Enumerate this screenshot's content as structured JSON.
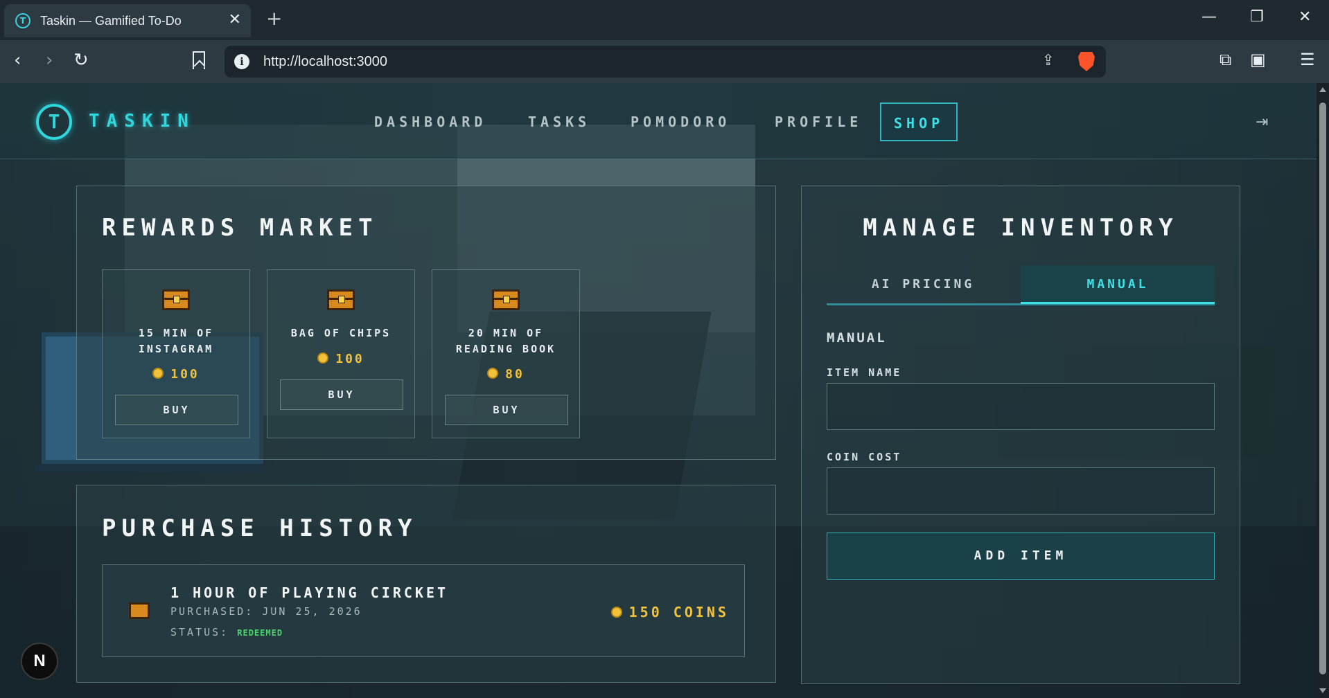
{
  "browser": {
    "tab_title": "Taskin — Gamified To-Do",
    "tab_close": "✕",
    "new_tab": "+",
    "url": "http://localhost:3000",
    "minimize": "—",
    "restore": "❐",
    "close": "✕"
  },
  "app": {
    "logo_letter": "T",
    "brand": "TASKIN",
    "nav": {
      "dashboard": "DASHBOARD",
      "tasks": "TASKS",
      "pomodoro": "POMODORO",
      "profile": "PROFILE",
      "shop": "SHOP"
    },
    "logout_icon": "logout-icon"
  },
  "market": {
    "title": "REWARDS MARKET",
    "items": [
      {
        "name_line1": "15 MIN OF",
        "name_line2": "INSTAGRAM",
        "price": "100",
        "buy": "BUY"
      },
      {
        "name_line1": "BAG OF CHIPS",
        "name_line2": "",
        "price": "100",
        "buy": "BUY"
      },
      {
        "name_line1": "20 MIN OF",
        "name_line2": "READING BOOK",
        "price": "80",
        "buy": "BUY"
      }
    ]
  },
  "history": {
    "title": "PURCHASE HISTORY",
    "entries": [
      {
        "name": "1 HOUR OF PLAYING CIRCKET",
        "purchased": "PURCHASED: JUN 25, 2026",
        "status_label": "STATUS:",
        "status_value": "REDEEMED",
        "coins": "150 COINS"
      }
    ]
  },
  "inventory": {
    "title": "MANAGE INVENTORY",
    "tabs": {
      "ai": "AI PRICING",
      "manual": "MANUAL"
    },
    "section_label": "MANUAL",
    "item_name_label": "ITEM NAME",
    "item_name_value": "",
    "coin_cost_label": "COIN COST",
    "coin_cost_value": "",
    "add_button": "ADD ITEM"
  },
  "dev_badge": "N",
  "colors": {
    "accent": "#2fd6dc",
    "gold": "#f2c33a",
    "redeemed": "#4ad36a"
  }
}
